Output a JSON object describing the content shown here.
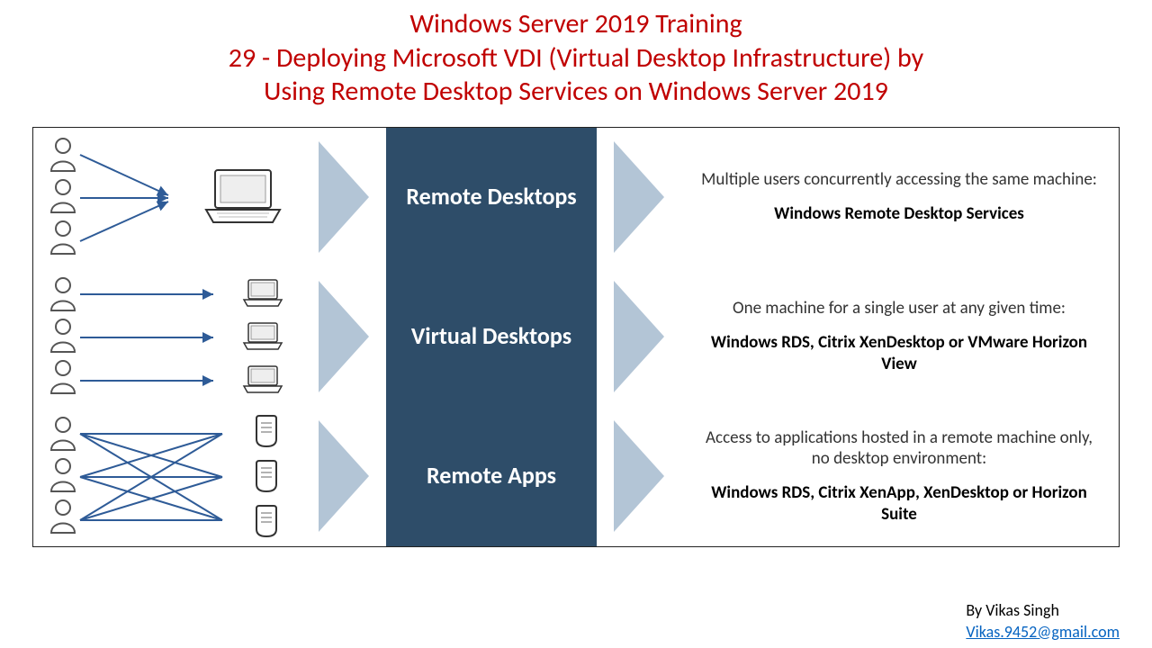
{
  "header": {
    "line1": "Windows Server 2019 Training",
    "line2": "29 - Deploying Microsoft VDI (Virtual Desktop Infrastructure) by",
    "line3": "Using Remote Desktop Services on Windows Server 2019"
  },
  "rows": [
    {
      "label": "Remote Desktops",
      "desc_top": "Multiple users concurrently accessing the same machine:",
      "desc_bottom": "Windows Remote Desktop Services"
    },
    {
      "label": "Virtual Desktops",
      "desc_top": "One machine for a single user at any given time:",
      "desc_bottom": "Windows RDS, Citrix XenDesktop or VMware Horizon View"
    },
    {
      "label": "Remote Apps",
      "desc_top": "Access to applications hosted in a remote machine only, no desktop environment:",
      "desc_bottom": "Windows RDS, Citrix XenApp, XenDesktop or Horizon Suite"
    }
  ],
  "footer": {
    "by": "By Vikas Singh",
    "email": "Vikas.9452@gmail.com"
  },
  "colors": {
    "title": "#c00000",
    "block": "#2e4d69",
    "tri": "#b3c5d6",
    "arrow": "#2e5b97"
  }
}
